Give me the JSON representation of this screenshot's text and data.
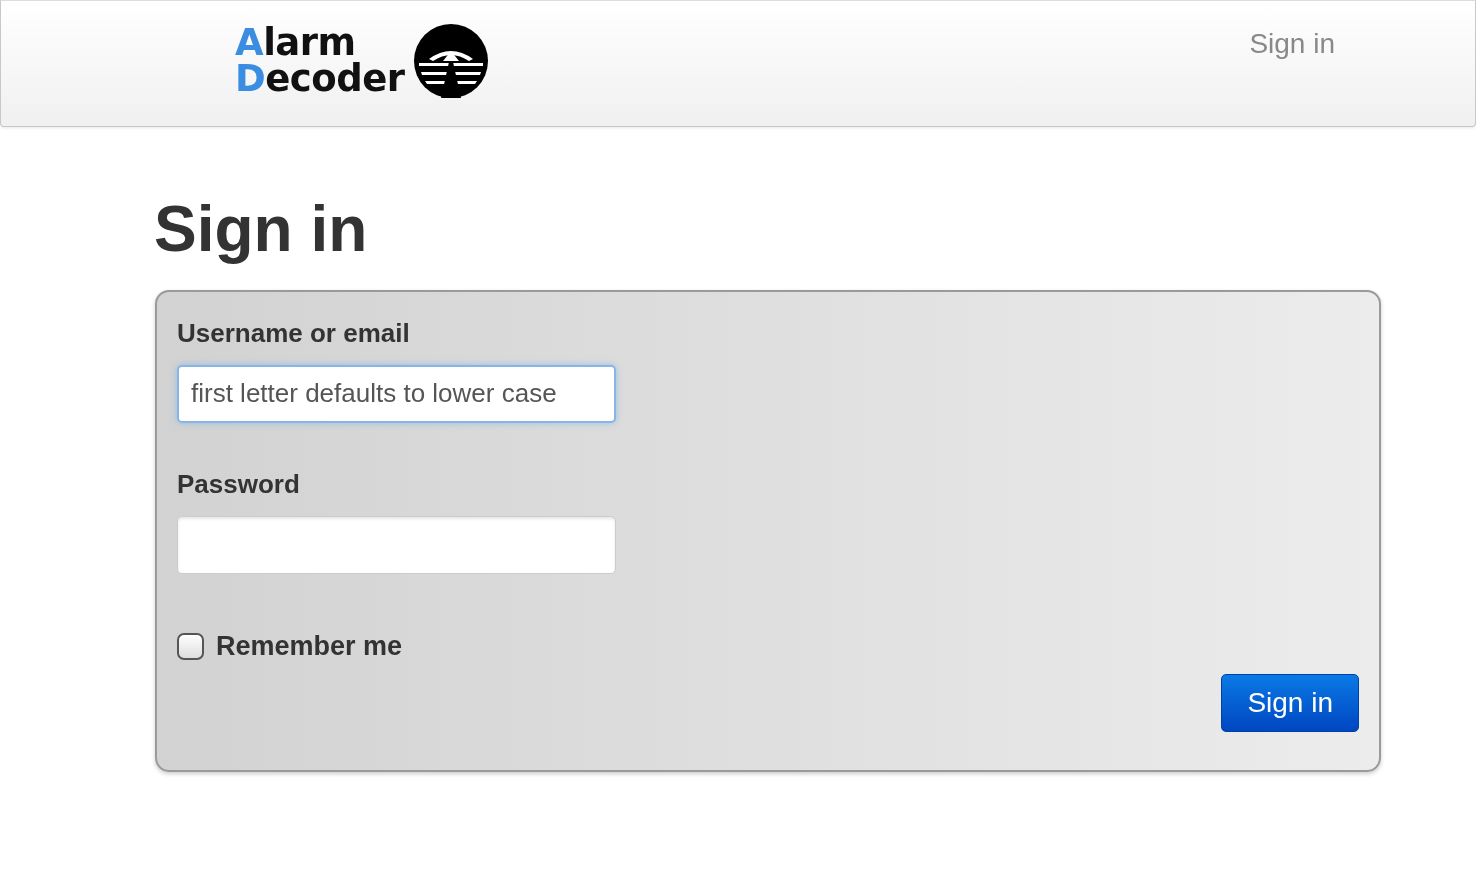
{
  "navbar": {
    "logo_lines": [
      "Alarm",
      "Decoder"
    ],
    "links": [
      {
        "label": "Sign in"
      }
    ]
  },
  "heading": "Sign in",
  "form": {
    "fields": [
      {
        "label": "Username or email",
        "kind": "text",
        "value": "first letter defaults to lower case",
        "focused": true
      },
      {
        "label": "Password",
        "kind": "password",
        "focused": false
      }
    ],
    "remember": {
      "label": "Remember me",
      "checked": false
    },
    "submit": "Sign in"
  }
}
